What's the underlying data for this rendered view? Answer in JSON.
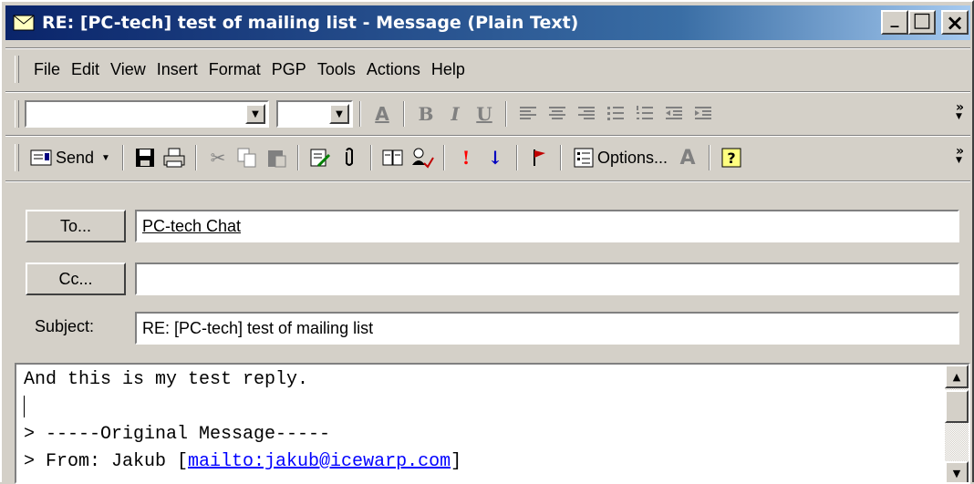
{
  "window": {
    "title": "RE: [PC-tech] test of mailing list - Message (Plain Text)",
    "minimize": "_",
    "maximize": "□",
    "close": "×"
  },
  "menu": [
    "File",
    "Edit",
    "View",
    "Insert",
    "Format",
    "PGP",
    "Tools",
    "Actions",
    "Help"
  ],
  "format_toolbar": {
    "font_value": "",
    "size_value": "",
    "buttons": [
      "font-color",
      "bold",
      "italic",
      "underline",
      "align-left",
      "center",
      "align-right",
      "bullets",
      "numbering",
      "decrease-indent",
      "increase-indent"
    ],
    "bold": "B",
    "italic": "I",
    "underline": "U",
    "font_color": "A"
  },
  "std_toolbar": {
    "send_label": "Send",
    "options_label": "Options...",
    "importance_high": "!",
    "importance_low": "↓"
  },
  "address": {
    "to_button": "To...",
    "to_value": "PC-tech Chat",
    "cc_button": "Cc...",
    "cc_value": "",
    "subject_label": "Subject:",
    "subject_value": "RE: [PC-tech] test of mailing list"
  },
  "body": {
    "line1": "And this is my test reply.",
    "line3": "> -----Original Message-----",
    "line4_prefix": "> From: Jakub [",
    "line4_link": "mailto:jakub@icewarp.com",
    "line4_suffix": "]"
  },
  "colors": {
    "titlebar_start": "#0a246a",
    "titlebar_end": "#a6caf0",
    "face": "#d4d0c8",
    "link": "#0000ff"
  }
}
